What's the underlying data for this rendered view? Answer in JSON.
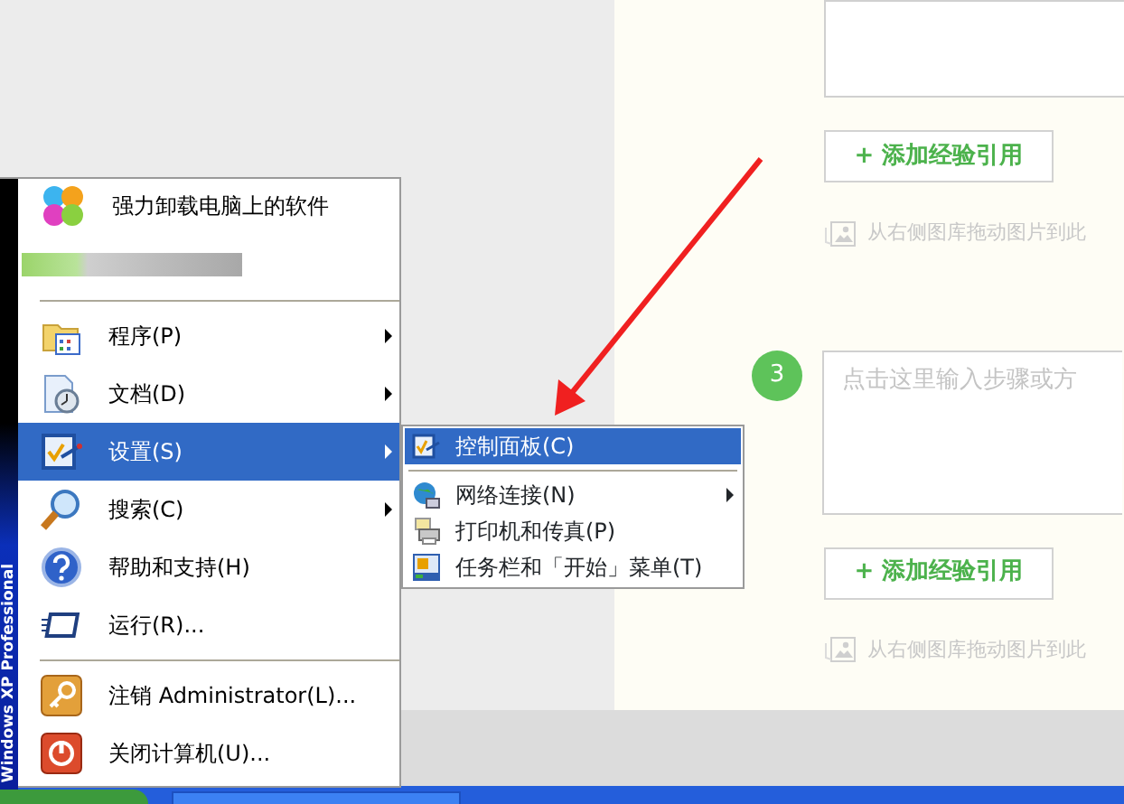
{
  "editor": {
    "steps": [
      {
        "add_button": "+ 添加经验引用",
        "image_hint": "从右侧图库拖动图片到此"
      },
      {
        "number": "3",
        "placeholder": "点击这里输入步骤或方",
        "add_button": "+ 添加经验引用",
        "image_hint": "从右侧图库拖动图片到此"
      }
    ]
  },
  "start_menu": {
    "side_banner": "Windows XP Professional",
    "pinned": [
      {
        "label": "强力卸载电脑上的软件"
      }
    ],
    "items": [
      {
        "label": "程序(P)",
        "submenu": true,
        "selected": false
      },
      {
        "label": "文档(D)",
        "submenu": true,
        "selected": false
      },
      {
        "label": "设置(S)",
        "submenu": true,
        "selected": true
      },
      {
        "label": "搜索(C)",
        "submenu": true,
        "selected": false
      },
      {
        "label": "帮助和支持(H)",
        "submenu": false,
        "selected": false
      },
      {
        "label": "运行(R)...",
        "submenu": false,
        "selected": false
      }
    ],
    "session_items": [
      {
        "label": "注销 Administrator(L)...",
        "selected": false
      },
      {
        "label": "关闭计算机(U)...",
        "selected": false
      }
    ]
  },
  "settings_submenu": {
    "groups": [
      {
        "items": [
          {
            "label": "控制面板(C)",
            "submenu": false,
            "selected": true
          }
        ]
      },
      {
        "items": [
          {
            "label": "网络连接(N)",
            "submenu": true,
            "selected": false
          },
          {
            "label": "打印机和传真(P)",
            "submenu": false,
            "selected": false
          },
          {
            "label": "任务栏和「开始」菜单(T)",
            "submenu": false,
            "selected": false
          }
        ]
      }
    ]
  }
}
